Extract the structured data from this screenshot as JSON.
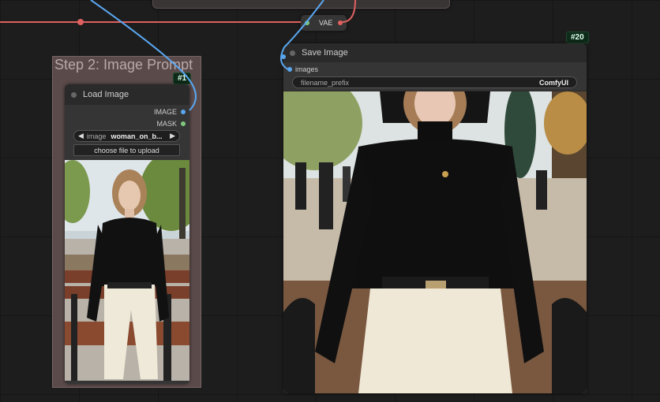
{
  "colors": {
    "wire_red": "#e06060",
    "wire_blue": "#5aa7f0",
    "node_bg": "#353535",
    "group_bg": "#5a4a4a"
  },
  "group": {
    "title": "Step 2: Image Prompt"
  },
  "load_image_node": {
    "badge": "#1",
    "title": "Load Image",
    "outputs": [
      "IMAGE",
      "MASK"
    ],
    "image_widget": {
      "label": "image",
      "value": "woman_on_b...",
      "prev": "◀",
      "next": "▶"
    },
    "upload_button": "choose file to upload"
  },
  "vae_node": {
    "label": "VAE"
  },
  "save_image_node": {
    "badge": "#20",
    "title": "Save Image",
    "input": "images",
    "filename_prefix": {
      "label": "filename_prefix",
      "value": "ComfyUI"
    }
  }
}
